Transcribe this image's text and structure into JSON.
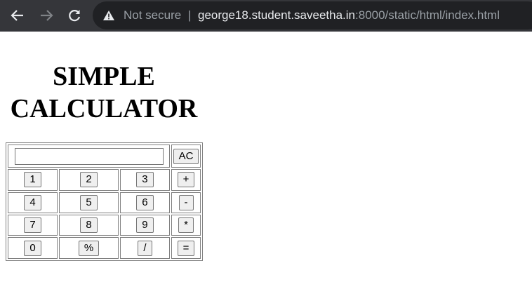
{
  "browser": {
    "not_secure_label": "Not secure",
    "separator": "|",
    "url_host": "george18.student.saveetha.in",
    "url_rest": ":8000/static/html/index.html",
    "icons": {
      "back": "back-arrow-icon",
      "forward": "forward-arrow-icon",
      "reload": "reload-icon",
      "warning": "warning-triangle-icon"
    }
  },
  "page": {
    "title_line1": "SIMPLE",
    "title_line2": "CALCULATOR"
  },
  "calculator": {
    "display_value": "",
    "clear_label": "AC",
    "rows": [
      [
        "1",
        "2",
        "3",
        "+"
      ],
      [
        "4",
        "5",
        "6",
        "-"
      ],
      [
        "7",
        "8",
        "9",
        "*"
      ],
      [
        "0",
        "%",
        "/",
        "="
      ]
    ]
  }
}
